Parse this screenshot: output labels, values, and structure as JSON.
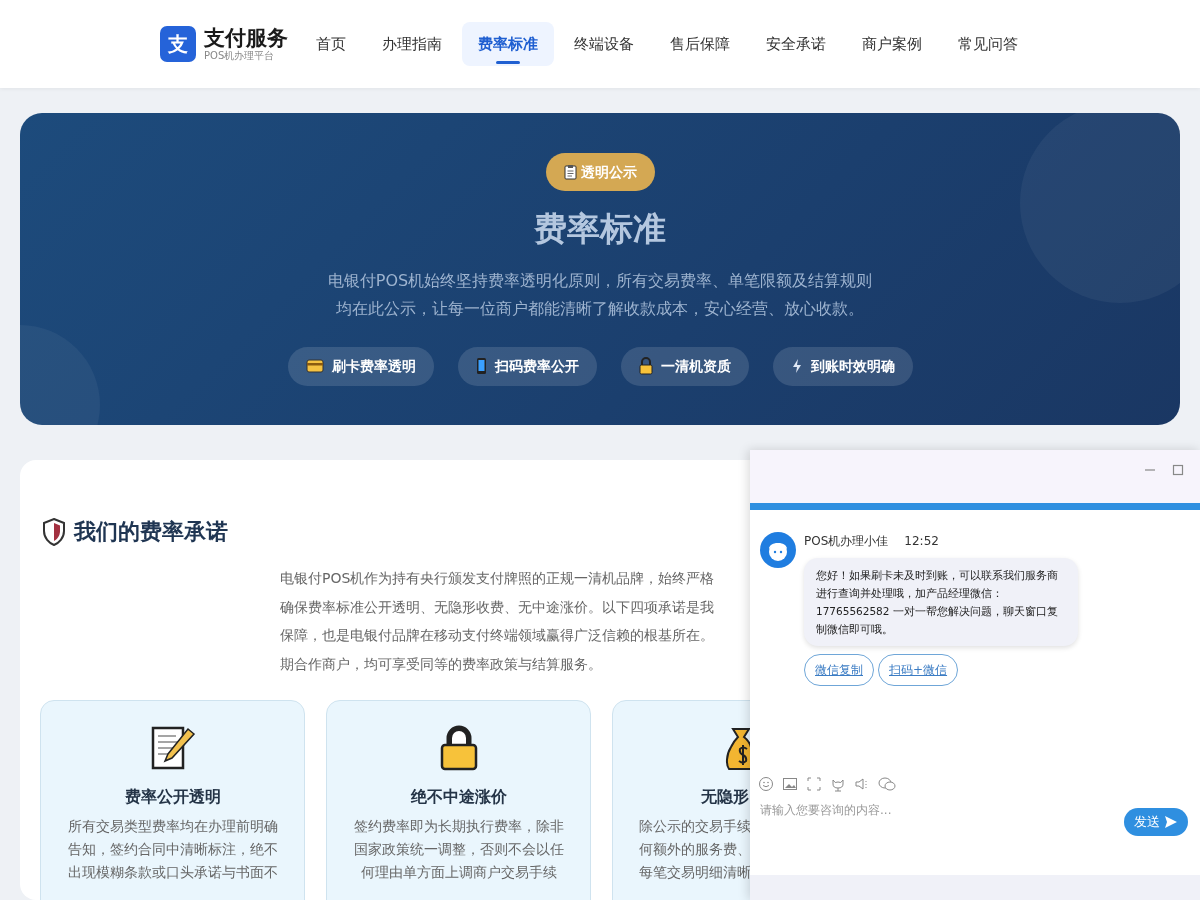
{
  "brand": {
    "logo_char": "支",
    "name": "支付服务",
    "tagline": "POS机办理平台"
  },
  "nav": [
    {
      "label": "首页",
      "selected": false
    },
    {
      "label": "办理指南",
      "selected": false
    },
    {
      "label": "费率标准",
      "selected": true
    },
    {
      "label": "终端设备",
      "selected": false
    },
    {
      "label": "售后保障",
      "selected": false
    },
    {
      "label": "安全承诺",
      "selected": false
    },
    {
      "label": "商户案例",
      "selected": false
    },
    {
      "label": "常见问答",
      "selected": false
    }
  ],
  "hero": {
    "badge": "透明公示",
    "title": "费率标准",
    "subtitle_lines": [
      "电银付POS机始终坚持费率透明化原则，所有交易费率、单笔限额及结算规则",
      "均在此公示，让每一位商户都能清晰了解收款成本，安心经营、放心收款。"
    ],
    "chips": [
      {
        "kind": "card",
        "label": "刷卡费率透明"
      },
      {
        "kind": "phone",
        "label": "扫码费率公开"
      },
      {
        "kind": "lock",
        "label": "一清机资质"
      },
      {
        "kind": "bolt",
        "label": "到账时效明确"
      }
    ]
  },
  "promise": {
    "title": "我们的费率承诺",
    "paragraph_lines": [
      "电银付POS机作为持有央行颁发支付牌照的正规一清机品牌，始终严格",
      "确保费率标准公开透明、无隐形收费、无中途涨价。以下四项承诺是我",
      "保障，也是电银付品牌在移动支付终端领域赢得广泛信赖的根基所在。",
      "期合作商户，均可享受同等的费率政策与结算服务。"
    ],
    "cards": [
      {
        "kind": "memo",
        "title": "费率公开透明",
        "description_lines": [
          "所有交易类型费率均在办理前明确",
          "告知，签约合同中清晰标注，绝不",
          "出现模糊条款或口头承诺与书面不"
        ]
      },
      {
        "kind": "lock",
        "title": "绝不中途涨价",
        "description_lines": [
          "签约费率即为长期执行费率，除非",
          "国家政策统一调整，否则不会以任",
          "何理由单方面上调商户交易手续"
        ]
      },
      {
        "kind": "moneybag",
        "title": "无隐形",
        "description_lines": [
          "除公示的交易手续",
          "何额外的服务费、",
          "每笔交易明细清晰"
        ]
      }
    ]
  },
  "chat": {
    "agent": "POS机办理小佳",
    "time": "12:52",
    "message": "您好！如果刷卡未及时到账，可以联系我们服务商进行查询并处理哦，加产品经理微信：17765562582 一对一帮您解决问题，聊天窗口复制微信即可哦。",
    "actions": [
      "微信复制",
      "扫码+微信"
    ],
    "placeholder": "请输入您要咨询的内容...",
    "send": "发送"
  }
}
